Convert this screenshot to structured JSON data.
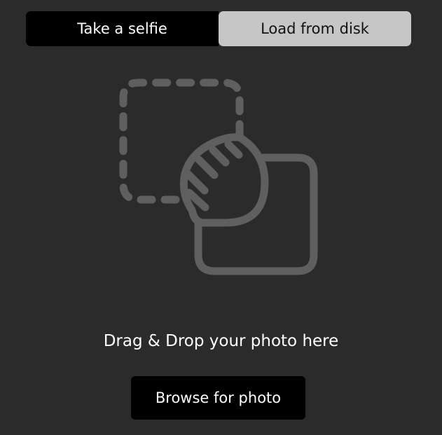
{
  "tabs": [
    {
      "label": "Take a selfie",
      "active": true
    },
    {
      "label": "Load from disk",
      "active": false
    }
  ],
  "dropzone": {
    "icon": "drag-drop-photo-icon",
    "text": "Drag & Drop your photo here"
  },
  "browse_button": {
    "label": "Browse for photo"
  },
  "colors": {
    "background": "#2b2b2b",
    "active_tab": "#000000",
    "inactive_tab": "#c6c6c6",
    "icon_stroke": "#5f5f5f",
    "text": "#ffffff"
  }
}
